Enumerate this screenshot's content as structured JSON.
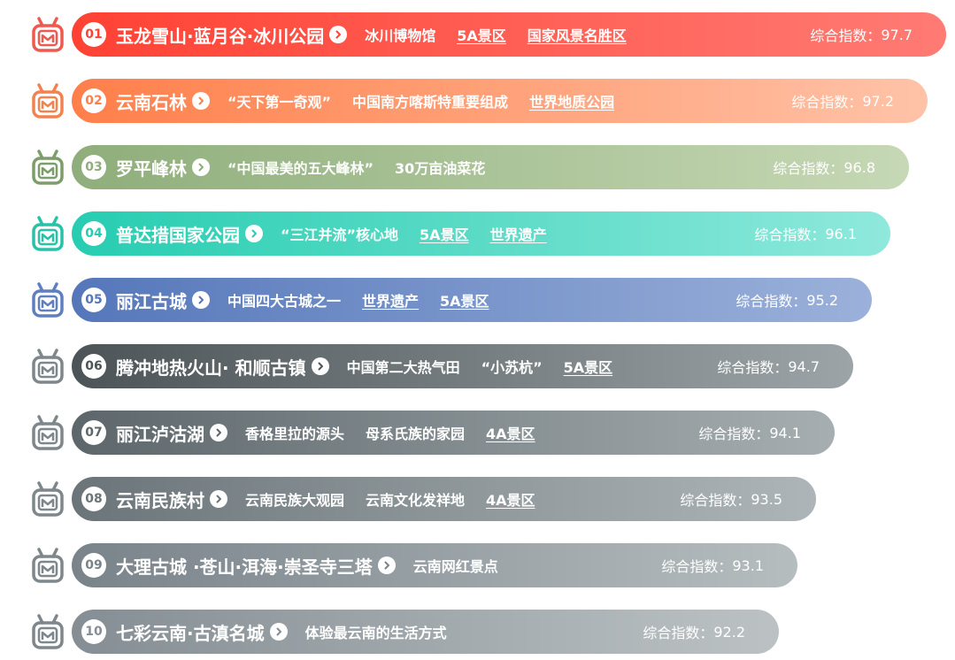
{
  "score_label": "综合指数：",
  "rows": [
    {
      "num": "01",
      "name": "玉龙雪山·蓝月谷·冰川公园",
      "tags": [
        "冰川博物馆",
        "5A景区",
        "国家风景名胜区"
      ],
      "tag_links": [
        false,
        true,
        true
      ],
      "score": "97.7",
      "color_from": "#ff4234",
      "color_to": "#ff7b74",
      "icon_color": "#f0594f"
    },
    {
      "num": "02",
      "name": "云南石林",
      "tags": [
        "“天下第一奇观”",
        "中国南方喀斯特重要组成",
        "世界地质公园"
      ],
      "tag_links": [
        false,
        false,
        true
      ],
      "score": "97.2",
      "color_from": "#ff7f4a",
      "color_to": "#ffc3a8",
      "icon_color": "#f4824f"
    },
    {
      "num": "03",
      "name": "罗平峰林",
      "tags": [
        "“中国最美的五大峰林”",
        "30万亩油菜花"
      ],
      "tag_links": [
        false,
        false
      ],
      "score": "96.8",
      "color_from": "#8fae7b",
      "color_to": "#c6d8b5",
      "icon_color": "#7d9e6a"
    },
    {
      "num": "04",
      "name": "普达措国家公园",
      "tags": [
        "“三江并流”核心地",
        "5A景区",
        "世界遗产"
      ],
      "tag_links": [
        false,
        true,
        true
      ],
      "score": "96.1",
      "color_from": "#27cdb1",
      "color_to": "#8fe9dc",
      "icon_color": "#27c2a8"
    },
    {
      "num": "05",
      "name": "丽江古城",
      "tags": [
        "中国四大古城之一",
        "世界遗产",
        "5A景区"
      ],
      "tag_links": [
        false,
        true,
        true
      ],
      "score": "95.2",
      "color_from": "#5577ba",
      "color_to": "#9bb1da",
      "icon_color": "#5f7fc0"
    },
    {
      "num": "06",
      "name": "腾冲地热火山· 和顺古镇",
      "tags": [
        "中国第二大热气田",
        "“小苏杭”",
        "5A景区"
      ],
      "tag_links": [
        false,
        false,
        true
      ],
      "score": "94.7",
      "color_from": "#4c5458",
      "color_to": "#9ca4a8",
      "icon_color": "#7d878c"
    },
    {
      "num": "07",
      "name": "丽江泸沽湖",
      "tags": [
        "香格里拉的源头",
        "母系氏族的家园",
        "4A景区"
      ],
      "tag_links": [
        false,
        false,
        true
      ],
      "score": "94.1",
      "color_from": "#5d676b",
      "color_to": "#a6aeb1",
      "icon_color": "#7d878c"
    },
    {
      "num": "08",
      "name": "云南民族村",
      "tags": [
        "云南民族大观园",
        "云南文化发祥地",
        "4A景区"
      ],
      "tag_links": [
        false,
        false,
        true
      ],
      "score": "93.5",
      "color_from": "#6b7579",
      "color_to": "#aeb5b8",
      "icon_color": "#7d878c"
    },
    {
      "num": "09",
      "name": "大理古城 ·苍山·洱海·崇圣寺三塔",
      "tags": [
        "云南网红景点"
      ],
      "tag_links": [
        false
      ],
      "score": "93.1",
      "color_from": "#79838a",
      "color_to": "#b6bdbf",
      "icon_color": "#7d878c"
    },
    {
      "num": "10",
      "name": "七彩云南·古滇名城",
      "tags": [
        "体验最云南的生活方式"
      ],
      "tag_links": [
        false
      ],
      "score": "92.2",
      "color_from": "#858e94",
      "color_to": "#bcc2c4",
      "icon_color": "#7d878c"
    }
  ],
  "icons": {
    "rank": "trophy-rank-icon",
    "arrow": "chevron-right-icon"
  }
}
